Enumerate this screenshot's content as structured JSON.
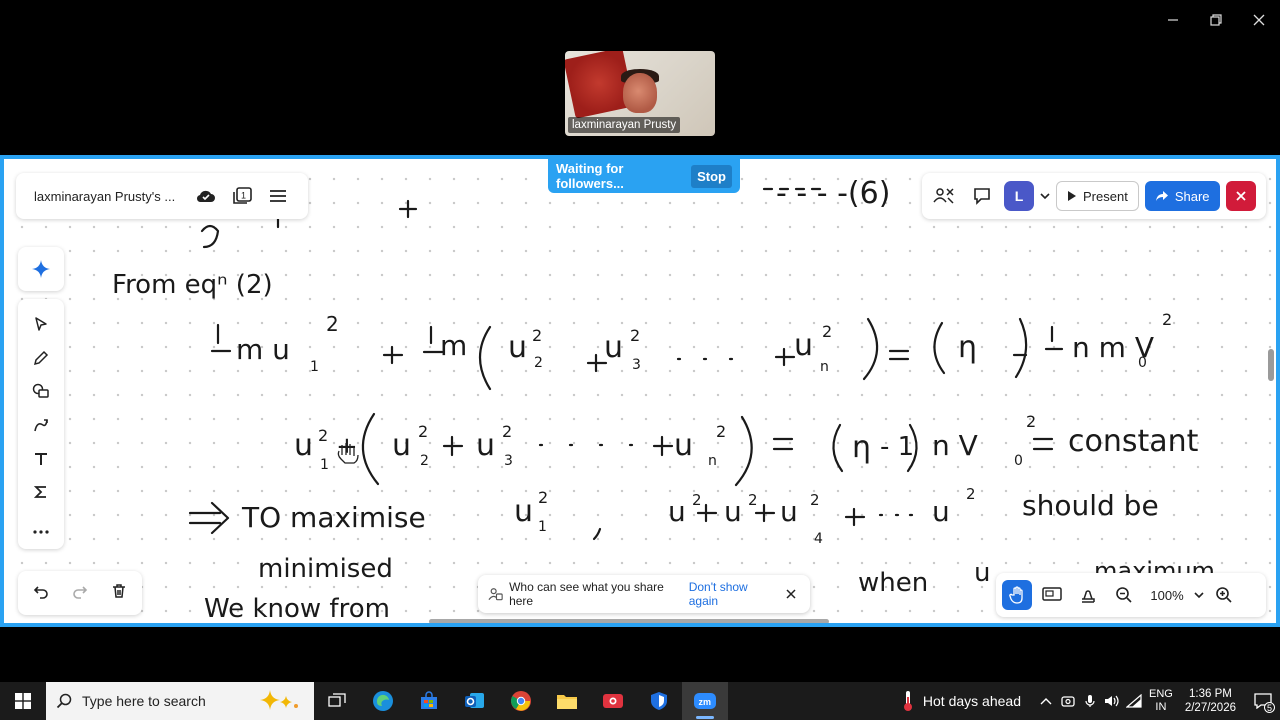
{
  "meeting": {
    "participant_name": "laxminarayan Prusty",
    "follow_status": "Waiting for followers...",
    "stop_label": "Stop"
  },
  "whiteboard": {
    "board_title": "laxminarayan Prusty's ...",
    "avatar_initial": "L",
    "present_label": "Present",
    "share_label": "Share",
    "zoom_level": "100%",
    "notice_text": "Who can see what you share here",
    "notice_link": "Don't show again"
  },
  "handwriting": {
    "line0_tail": "- - - -(6)",
    "line1": "From eqⁿ (2)",
    "line4_lead": "⇒ TO maximise",
    "line4_tail": "should be",
    "line5": "minimised",
    "line6_left": "We know from",
    "line6_right": "when",
    "constant_word": "constant"
  },
  "taskbar": {
    "search_placeholder": "Type here to search",
    "weather": "Hot days ahead",
    "lang_top": "ENG",
    "lang_bottom": "IN",
    "time": "1:36 PM",
    "date": "2/27/2026",
    "notif_count": "5"
  },
  "colors": {
    "share_border": "#2aa2f2",
    "primary_blue": "#1e6fe0",
    "close_red": "#d11b3a",
    "avatar": "#4a58c8"
  }
}
